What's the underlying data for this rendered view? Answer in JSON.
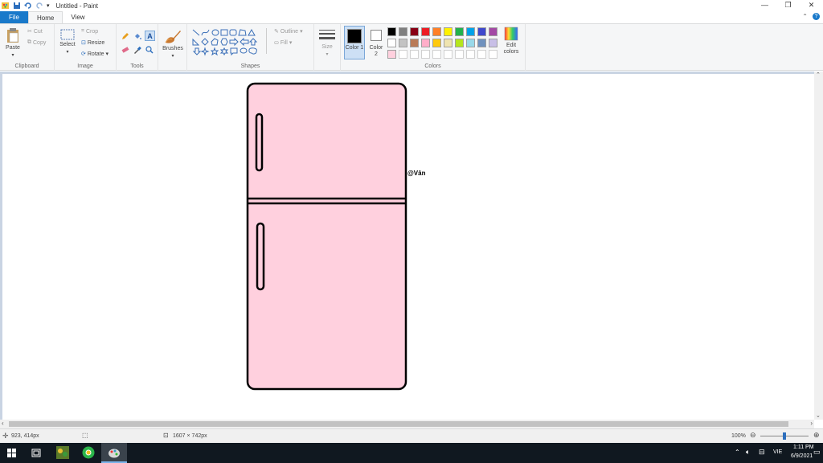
{
  "window": {
    "title": "Untitled - Paint",
    "controls": [
      "—",
      "❐",
      "✕"
    ]
  },
  "tabs": {
    "file": "File",
    "home": "Home",
    "view": "View"
  },
  "ribbon": {
    "clipboard": {
      "label": "Clipboard",
      "paste": "Paste",
      "cut": "Cut",
      "copy": "Copy"
    },
    "image": {
      "label": "Image",
      "select": "Select",
      "crop": "Crop",
      "resize": "Resize",
      "rotate": "Rotate"
    },
    "tools": {
      "label": "Tools"
    },
    "brushes": {
      "label": "Brushes"
    },
    "shapes": {
      "label": "Shapes",
      "outline": "Outline",
      "fill": "Fill"
    },
    "size": {
      "label": "Size"
    },
    "colors": {
      "label": "Colors",
      "color1": "Color 1",
      "color2": "Color 2",
      "edit": "Edit colors",
      "color1_value": "#000000",
      "color2_value": "#ffffff",
      "palette_row1": [
        "#000000",
        "#7f7f7f",
        "#880015",
        "#ed1c24",
        "#ff7f27",
        "#fff200",
        "#22b14c",
        "#00a2e8",
        "#3f48cc",
        "#a349a4"
      ],
      "palette_row2": [
        "#ffffff",
        "#c3c3c3",
        "#b97a57",
        "#ffaec9",
        "#ffc90e",
        "#efe4b0",
        "#b5e61d",
        "#99d9ea",
        "#7092be",
        "#c8bfe7"
      ],
      "palette_row3": [
        "#ffd0de",
        "#ffffff",
        "#ffffff",
        "#ffffff",
        "#ffffff",
        "#ffffff",
        "#ffffff",
        "#ffffff",
        "#ffffff",
        "#ffffff"
      ]
    }
  },
  "drawing": {
    "signature": "@Vân",
    "fridge_color": "#ffd0de"
  },
  "status": {
    "cursor": "923, 414px",
    "image_size": "1607 × 742px",
    "zoom": "100%",
    "zoom_level": 0.5
  },
  "taskbar": {
    "time": "1:11 PM",
    "date": "6/9/2021",
    "lang": "VIE"
  }
}
